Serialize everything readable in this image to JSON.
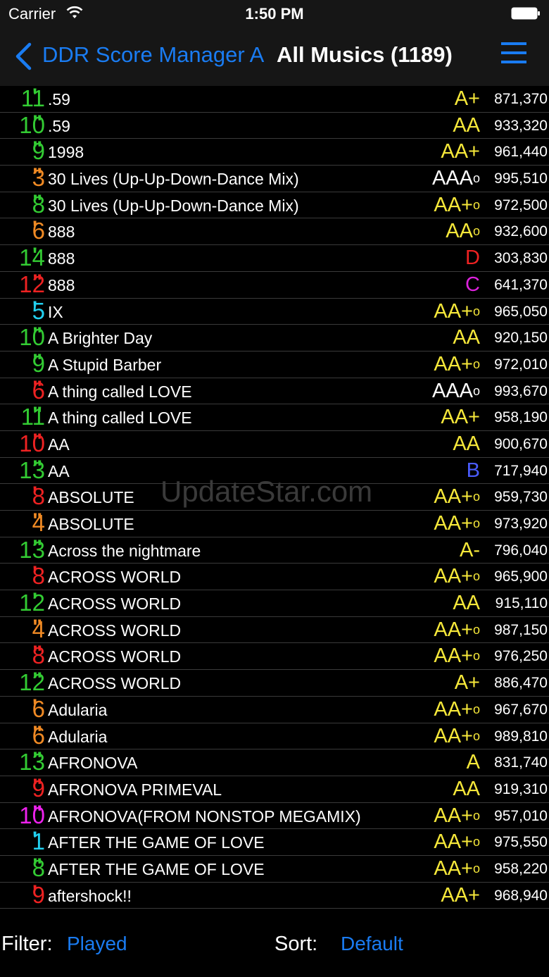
{
  "status": {
    "carrier": "Carrier",
    "time": "1:50 PM"
  },
  "nav": {
    "back_label": "DDR Score Manager A",
    "title": "All Musics (1189)"
  },
  "watermark": "UpdateStar.com",
  "colors": {
    "accent": "#1a7cf2",
    "level_green": "#33cc33",
    "level_orange": "#f08a24",
    "level_red": "#ee2222",
    "level_cyan": "#22d0f0",
    "level_magenta": "#ee22ee",
    "rank_yellow": "#f6e83a",
    "rank_white": "#ffffff",
    "rank_D": "#ee2222",
    "rank_C": "#dd22dd",
    "rank_B": "#4a5cff"
  },
  "rows": [
    {
      "level": "11",
      "mark": "'",
      "level_color": "#33cc33",
      "title": ".59",
      "rank": "A+",
      "rank_sup": "",
      "rank_color": "#f6e83a",
      "score": "871,370"
    },
    {
      "level": "10",
      "mark": "\"",
      "level_color": "#33cc33",
      "title": ".59",
      "rank": "AA",
      "rank_sup": "",
      "rank_color": "#f6e83a",
      "score": "933,320"
    },
    {
      "level": "9",
      "mark": "\"",
      "level_color": "#33cc33",
      "title": "1998",
      "rank": "AA+",
      "rank_sup": "",
      "rank_color": "#f6e83a",
      "score": "961,440"
    },
    {
      "level": "3",
      "mark": "\"",
      "level_color": "#f08a24",
      "title": "30 Lives (Up-Up-Down-Dance Mix)",
      "rank": "AAA",
      "rank_sup": "o",
      "rank_color": "#ffffff",
      "score": "995,510"
    },
    {
      "level": "8",
      "mark": "\"",
      "level_color": "#33cc33",
      "title": "30 Lives (Up-Up-Down-Dance Mix)",
      "rank": "AA+",
      "rank_sup": "o",
      "rank_color": "#f6e83a",
      "score": "972,500"
    },
    {
      "level": "6",
      "mark": "'",
      "level_color": "#f08a24",
      "title": "888",
      "rank": "AA",
      "rank_sup": "o",
      "rank_color": "#f6e83a",
      "score": "932,600"
    },
    {
      "level": "14",
      "mark": "'",
      "level_color": "#33cc33",
      "title": "888",
      "rank": "D",
      "rank_sup": "",
      "rank_color": "#ee2222",
      "score": "303,830"
    },
    {
      "level": "12",
      "mark": "\"",
      "level_color": "#ee2222",
      "title": "888",
      "rank": "C",
      "rank_sup": "",
      "rank_color": "#dd22dd",
      "score": "641,370"
    },
    {
      "level": "5",
      "mark": "'",
      "level_color": "#22d0f0",
      "title": "IX",
      "rank": "AA+",
      "rank_sup": "o",
      "rank_color": "#f6e83a",
      "score": "965,050"
    },
    {
      "level": "10",
      "mark": "\"",
      "level_color": "#33cc33",
      "title": "A Brighter Day",
      "rank": "AA",
      "rank_sup": "",
      "rank_color": "#f6e83a",
      "score": "920,150"
    },
    {
      "level": "9",
      "mark": "\"",
      "level_color": "#33cc33",
      "title": "A Stupid Barber",
      "rank": "AA+",
      "rank_sup": "o",
      "rank_color": "#f6e83a",
      "score": "972,010"
    },
    {
      "level": "6",
      "mark": "\"",
      "level_color": "#ee2222",
      "title": "A thing called LOVE",
      "rank": "AAA",
      "rank_sup": "o",
      "rank_color": "#ffffff",
      "score": "993,670"
    },
    {
      "level": "11",
      "mark": "\"",
      "level_color": "#33cc33",
      "title": "A thing called LOVE",
      "rank": "AA+",
      "rank_sup": "",
      "rank_color": "#f6e83a",
      "score": "958,190"
    },
    {
      "level": "10",
      "mark": "\"",
      "level_color": "#ee2222",
      "title": "AA",
      "rank": "AA",
      "rank_sup": "",
      "rank_color": "#f6e83a",
      "score": "900,670"
    },
    {
      "level": "13",
      "mark": "\"",
      "level_color": "#33cc33",
      "title": "AA",
      "rank": "B",
      "rank_sup": "",
      "rank_color": "#4a5cff",
      "score": "717,940"
    },
    {
      "level": "8",
      "mark": "'",
      "level_color": "#ee2222",
      "title": "ABSOLUTE",
      "rank": "AA+",
      "rank_sup": "o",
      "rank_color": "#f6e83a",
      "score": "959,730"
    },
    {
      "level": "4",
      "mark": "\"",
      "level_color": "#f08a24",
      "title": "ABSOLUTE",
      "rank": "AA+",
      "rank_sup": "o",
      "rank_color": "#f6e83a",
      "score": "973,920"
    },
    {
      "level": "13",
      "mark": "\"",
      "level_color": "#33cc33",
      "title": "Across the nightmare",
      "rank": "A-",
      "rank_sup": "",
      "rank_color": "#f6e83a",
      "score": "796,040"
    },
    {
      "level": "8",
      "mark": "'",
      "level_color": "#ee2222",
      "title": "ACROSS WORLD",
      "rank": "AA+",
      "rank_sup": "o",
      "rank_color": "#f6e83a",
      "score": "965,900"
    },
    {
      "level": "12",
      "mark": "'",
      "level_color": "#33cc33",
      "title": "ACROSS WORLD",
      "rank": "AA",
      "rank_sup": "",
      "rank_color": "#f6e83a",
      "score": "915,110"
    },
    {
      "level": "4",
      "mark": "\"",
      "level_color": "#f08a24",
      "title": "ACROSS WORLD",
      "rank": "AA+",
      "rank_sup": "o",
      "rank_color": "#f6e83a",
      "score": "987,150"
    },
    {
      "level": "8",
      "mark": "\"",
      "level_color": "#ee2222",
      "title": "ACROSS WORLD",
      "rank": "AA+",
      "rank_sup": "o",
      "rank_color": "#f6e83a",
      "score": "976,250"
    },
    {
      "level": "12",
      "mark": "\"",
      "level_color": "#33cc33",
      "title": "ACROSS WORLD",
      "rank": "A+",
      "rank_sup": "",
      "rank_color": "#f6e83a",
      "score": "886,470"
    },
    {
      "level": "6",
      "mark": "'",
      "level_color": "#f08a24",
      "title": "Adularia",
      "rank": "AA+",
      "rank_sup": "o",
      "rank_color": "#f6e83a",
      "score": "967,670"
    },
    {
      "level": "6",
      "mark": "\"",
      "level_color": "#f08a24",
      "title": "Adularia",
      "rank": "AA+",
      "rank_sup": "o",
      "rank_color": "#f6e83a",
      "score": "989,810"
    },
    {
      "level": "13",
      "mark": "\"",
      "level_color": "#33cc33",
      "title": "AFRONOVA",
      "rank": "A",
      "rank_sup": "",
      "rank_color": "#f6e83a",
      "score": "831,740"
    },
    {
      "level": "9",
      "mark": "\"",
      "level_color": "#ee2222",
      "title": "AFRONOVA PRIMEVAL",
      "rank": "AA",
      "rank_sup": "",
      "rank_color": "#f6e83a",
      "score": "919,310"
    },
    {
      "level": "10",
      "mark": "\"",
      "level_color": "#ee22ee",
      "title": "AFRONOVA(FROM NONSTOP MEGAMIX)",
      "rank": "AA+",
      "rank_sup": "o",
      "rank_color": "#f6e83a",
      "score": "957,010"
    },
    {
      "level": "1",
      "mark": "'",
      "level_color": "#22d0f0",
      "title": "AFTER THE GAME OF LOVE",
      "rank": "AA+",
      "rank_sup": "o",
      "rank_color": "#f6e83a",
      "score": "975,550"
    },
    {
      "level": "8",
      "mark": "\"",
      "level_color": "#33cc33",
      "title": "AFTER THE GAME OF LOVE",
      "rank": "AA+",
      "rank_sup": "o",
      "rank_color": "#f6e83a",
      "score": "958,220"
    },
    {
      "level": "9",
      "mark": "'",
      "level_color": "#ee2222",
      "title": "aftershock!!",
      "rank": "AA+",
      "rank_sup": "",
      "rank_color": "#f6e83a",
      "score": "968,940"
    }
  ],
  "footer": {
    "filter_label": "Filter:",
    "filter_value": "Played",
    "sort_label": "Sort:",
    "sort_value": "Default"
  }
}
